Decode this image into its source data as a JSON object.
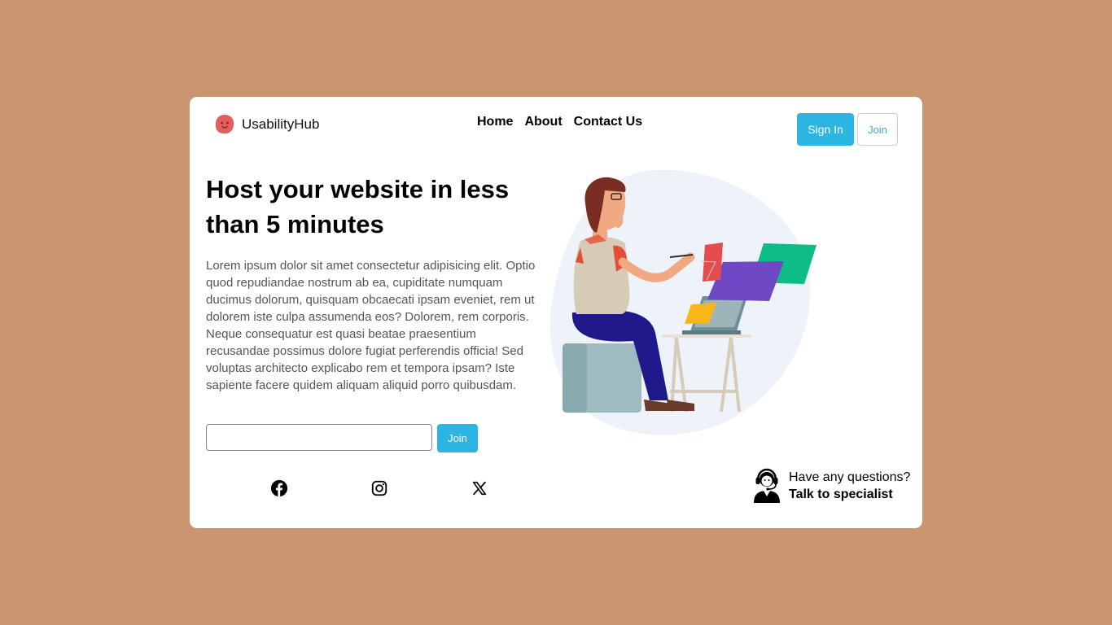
{
  "brand": {
    "name": "UsabilityHub",
    "logo_icon": "smiley-blob-icon",
    "logo_color": "#e0605f"
  },
  "nav": {
    "items": [
      "Home",
      "About",
      "Contact Us"
    ]
  },
  "auth": {
    "sign_in_label": "Sign In",
    "join_label": "Join"
  },
  "hero": {
    "title": "Host your website in less than 5 minutes",
    "body": "Lorem ipsum dolor sit amet consectetur adipisicing elit. Optio quod repudiandae nostrum ab ea, cupiditate numquam ducimus dolorum, quisquam obcaecati ipsam eveniet, rem ut dolorem iste culpa assumenda eos? Dolorem, rem corporis. Neque consequatur est quasi beatae praesentium recusandae possimus dolore fugiat perferendis officia! Sed voluptas architecto explicabo rem et tempora ipsam? Iste sapiente facere quidem aliquam aliquid porro quibusdam.",
    "email_value": "",
    "join_label": "Join"
  },
  "social": {
    "icons": [
      "facebook-icon",
      "instagram-icon",
      "x-icon"
    ]
  },
  "support": {
    "question": "Have any questions?",
    "cta": "Talk to specialist",
    "icon": "headset-agent-icon"
  },
  "colors": {
    "background": "#c9966f",
    "card": "#ffffff",
    "accent": "#2bb5e3"
  }
}
